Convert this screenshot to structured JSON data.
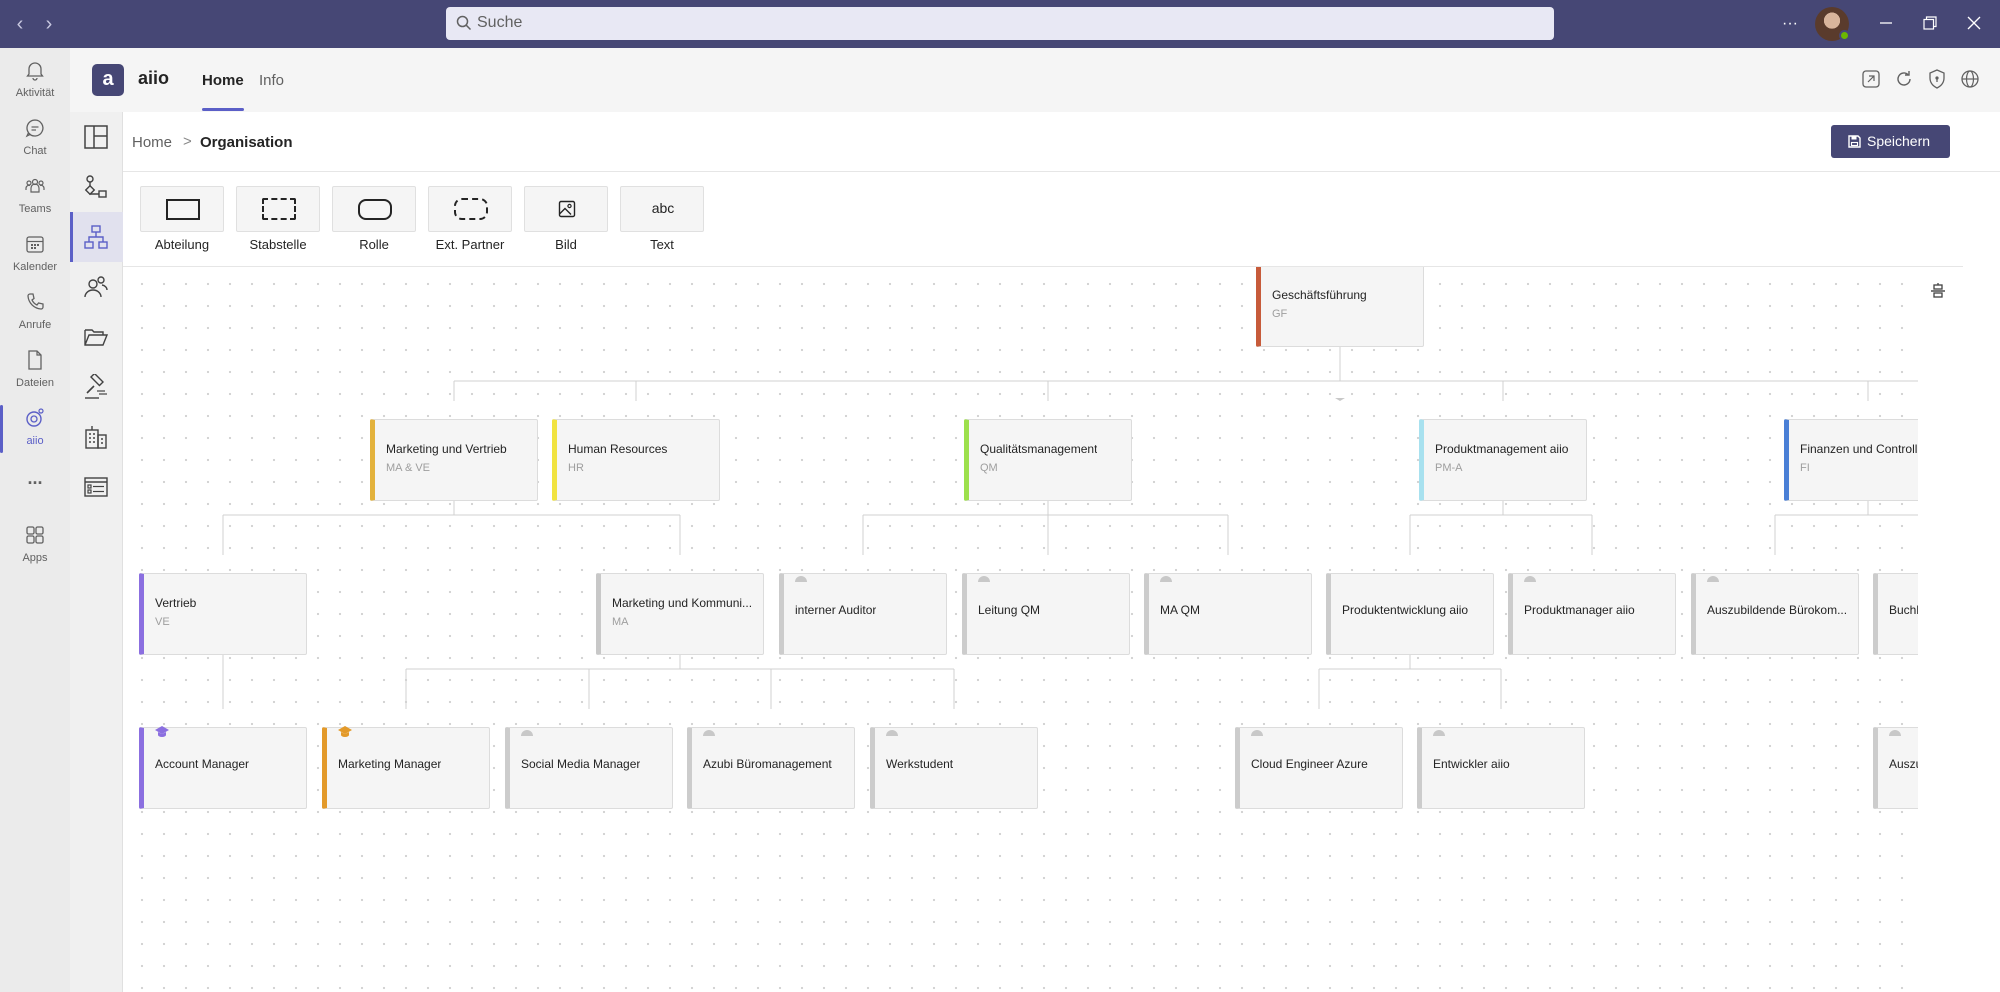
{
  "search": {
    "placeholder": "Suche"
  },
  "titlebar": {
    "more": "···"
  },
  "rail": [
    {
      "label": "Aktivität",
      "icon": "bell-icon"
    },
    {
      "label": "Chat",
      "icon": "chat-icon"
    },
    {
      "label": "Teams",
      "icon": "teams-icon"
    },
    {
      "label": "Kalender",
      "icon": "calendar-icon"
    },
    {
      "label": "Anrufe",
      "icon": "phone-icon"
    },
    {
      "label": "Dateien",
      "icon": "file-icon"
    },
    {
      "label": "aiio",
      "icon": "aiio-icon"
    },
    {
      "label": "...",
      "icon": "more-icon"
    },
    {
      "label": "Apps",
      "icon": "apps-icon"
    }
  ],
  "app": {
    "logo": "a",
    "name": "aiio",
    "tabs": [
      "Home",
      "Info"
    ]
  },
  "breadcrumb": {
    "home": "Home",
    "sep": ">",
    "current": "Organisation"
  },
  "save_label": "Speichern",
  "palette": [
    "Abteilung",
    "Stabstelle",
    "Rolle",
    "Ext. Partner",
    "Bild",
    "Text"
  ],
  "palette_text_glyph": "abc",
  "colors": {
    "teams_purple": "#464775",
    "accent": "#5b5fc7",
    "gf": "#c75b3a",
    "mv": "#e3b23c",
    "hr": "#f1e340",
    "qm": "#9de04c",
    "pm": "#a8e1ef",
    "fi": "#4a7fd6",
    "ve": "#8b6fe0",
    "mm": "#e39a2a",
    "role_grey": "#c8c8c8"
  },
  "org": {
    "gf": {
      "title": "Geschäftsführung",
      "short": "GF"
    },
    "mv": {
      "title": "Marketing und Vertrieb",
      "short": "MA & VE"
    },
    "hr": {
      "title": "Human Resources",
      "short": "HR"
    },
    "qm": {
      "title": "Qualitätsmanagement",
      "short": "QM"
    },
    "pm": {
      "title": "Produktmanagement aiio",
      "short": "PM-A"
    },
    "fi": {
      "title": "Finanzen und Controllin",
      "short": "FI"
    },
    "ve": {
      "title": "Vertrieb",
      "short": "VE"
    },
    "ma": {
      "title": "Marketing und Kommuni...",
      "short": "MA"
    },
    "ia": {
      "title": "interner Auditor"
    },
    "lq": {
      "title": "Leitung QM"
    },
    "mq": {
      "title": "MA QM"
    },
    "pe": {
      "title": "Produktentwicklung aiio"
    },
    "pmg": {
      "title": "Produktmanager aiio"
    },
    "ab": {
      "title": "Auszubildende Bürokom..."
    },
    "bu": {
      "title": "Buchh"
    },
    "am": {
      "title": "Account Manager"
    },
    "mm": {
      "title": "Marketing Manager"
    },
    "sm": {
      "title": "Social Media Manager"
    },
    "az": {
      "title": "Azubi Büromanagement"
    },
    "ws": {
      "title": "Werkstudent"
    },
    "ce": {
      "title": "Cloud Engineer Azure"
    },
    "ea": {
      "title": "Entwickler aiio"
    },
    "au": {
      "title": "Auszu"
    }
  }
}
